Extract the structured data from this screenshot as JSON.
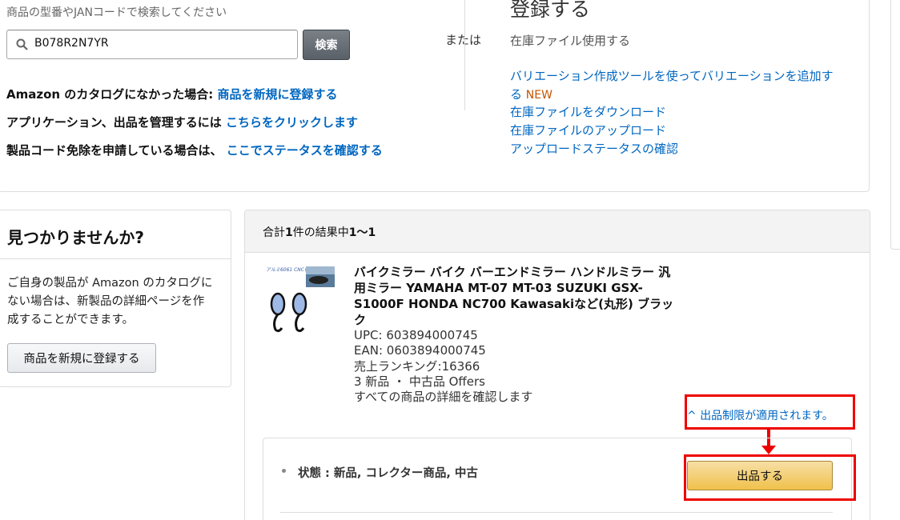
{
  "search": {
    "hint": "商品の型番やJANコードで検索してください",
    "value": "B078R2N7YR",
    "button_label": "検索"
  },
  "catalog_lines": [
    {
      "text": "Amazon のカタログになかった場合: ",
      "link": "商品を新規に登録する"
    },
    {
      "text": "アプリケーション、出品を管理するには ",
      "link": "こちらをクリックします"
    },
    {
      "text": "製品コード免除を申請している場合は、 ",
      "link": "ここでステータスを確認する"
    }
  ],
  "or_label": "または",
  "register_panel": {
    "title": "登録する",
    "inventory_file_use": "在庫ファイル使用する",
    "variation_link_line1": "バリエーション作成ツールを使ってバリエーションを追加す",
    "variation_link_line2": "る",
    "new_badge": "NEW",
    "links": [
      "在庫ファイルをダウンロード",
      "在庫ファイルのアップロード",
      "アップロードステータスの確認"
    ]
  },
  "not_found": {
    "title": "見つかりませんか?",
    "description": "ご自身の製品が Amazon のカタログにない場合は、新製品の詳細ページを作成することができます。",
    "button_label": "商品を新規に登録する"
  },
  "results": {
    "count_prefix": "合計",
    "count_bold": "1",
    "count_mid": "件の結果中",
    "count_range": "1～1",
    "product": {
      "thumb_caption": "アルミ6061 CNC仕上げ",
      "title": "バイクミラー バイク バーエンドミラー ハンドルミラー 汎用ミラー YAMAHA MT-07 MT-03 SUZUKI GSX-S1000F HONDA NC700 Kawasakiなど(丸形) ブラック",
      "upc": "UPC: 603894000745",
      "ean": "EAN: 0603894000745",
      "rank": "売上ランキング:16366",
      "offers": "3 新品 ・ 中古品 Offers",
      "details_link": "すべての商品の詳細を確認します"
    },
    "restriction_text": "出品制限が適用されます。",
    "restriction_caret": "^",
    "offer": {
      "condition": "状態 : 新品, コレクター商品, 中古",
      "list_button": "出品する"
    }
  },
  "colors": {
    "link": "#0066c0",
    "annotation_red": "#e00000",
    "primary_button": "#f0c14b",
    "new_badge": "#c45500"
  }
}
